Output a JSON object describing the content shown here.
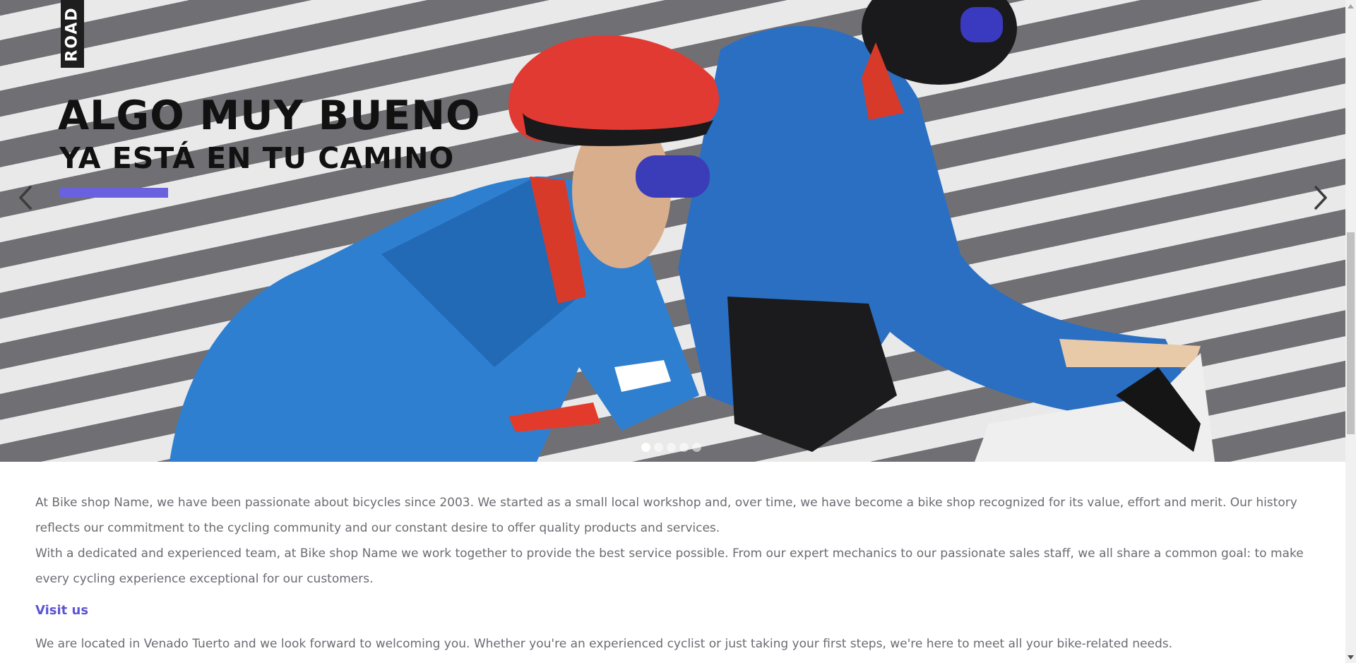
{
  "hero": {
    "tag": "ROAD",
    "headline_1": "ALGO MUY BUENO",
    "headline_2": "YA ESTÁ EN TU CAMINO",
    "accent_color": "#6961de",
    "prev_icon": "chevron-left-icon",
    "next_icon": "chevron-right-icon",
    "slide_count": 5,
    "active_slide": 1
  },
  "content": {
    "para_1": "At Bike shop Name, we have been passionate about bicycles since 2003. We started as a small local workshop and, over time, we have become a bike shop recognized for its value, effort and merit. Our history reflects our commitment to the cycling community and our constant desire to offer quality products and services.",
    "para_2": "With a dedicated and experienced team, at Bike shop Name we work together to provide the best service possible. From our expert mechanics to our passionate sales staff, we all share a common goal: to make every cycling experience exceptional for our customers.",
    "visit_title": "Visit us",
    "para_3": "We are located in Venado Tuerto and we look forward to welcoming you. Whether you're an experienced cyclist or just taking your first steps, we're here to meet all your bike-related needs."
  },
  "colors": {
    "link": "#5b54d6",
    "body_text": "#6b6b72"
  }
}
